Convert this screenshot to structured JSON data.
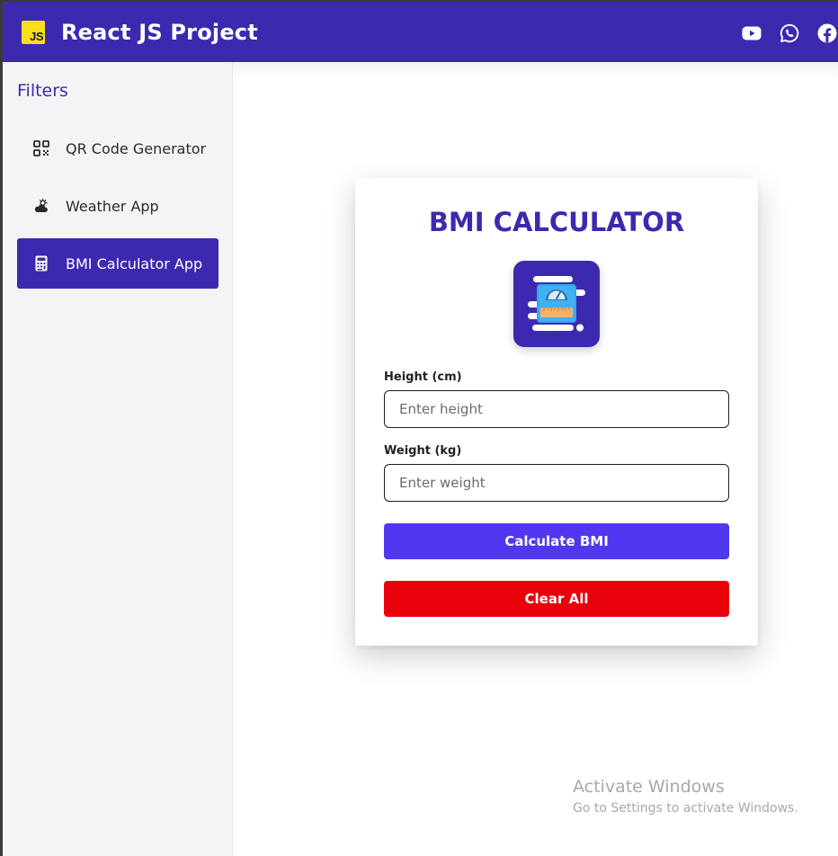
{
  "header": {
    "logo_text": "JS",
    "title": "React JS Project",
    "social_icons": [
      "youtube-icon",
      "whatsapp-icon",
      "facebook-icon"
    ]
  },
  "sidebar": {
    "title": "Filters",
    "items": [
      {
        "label": "QR Code Generator",
        "icon": "qr-code-icon",
        "active": false
      },
      {
        "label": "Weather App",
        "icon": "cloud-sun-icon",
        "active": false
      },
      {
        "label": "BMI Calculator App",
        "icon": "calculator-icon",
        "active": true
      }
    ]
  },
  "calculator": {
    "title": "BMI CALCULATOR",
    "height_label": "Height (cm)",
    "height_placeholder": "Enter height",
    "height_value": "",
    "weight_label": "Weight (kg)",
    "weight_placeholder": "Enter weight",
    "weight_value": "",
    "calculate_label": "Calculate BMI",
    "clear_label": "Clear All"
  },
  "watermark": {
    "line1": "Activate Windows",
    "line2": "Go to Settings to activate Windows."
  },
  "colors": {
    "brand": "#3b2ab0",
    "calculate_button": "#5038f0",
    "clear_button": "#e8000b",
    "sidebar_bg": "#f3f4f6"
  }
}
